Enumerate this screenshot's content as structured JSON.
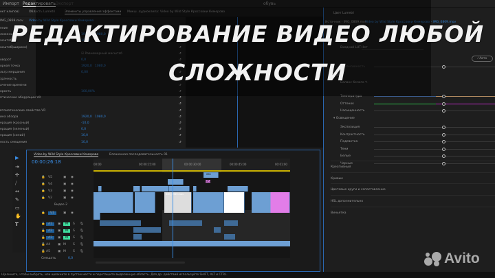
{
  "topbar": {
    "tabs": [
      "Импорт",
      "Редактировать",
      "Экспорт"
    ],
    "active": 1,
    "project": "обувь"
  },
  "panels": {
    "tabs": [
      "ект клипов)",
      "Область Lumetri",
      "Элементы управления эффектами",
      "Микш. аудиоклипа: Video by Wild Style Кроссовки Кемерово"
    ],
    "clip": "IMG_0869.mov",
    "seq": "Video by Wild Style Кроссовки Кемерово"
  },
  "effects": [
    {
      "l": "ение"
    },
    {
      "l": "ложение",
      "v": "1920,0",
      "v2": "1080,0"
    },
    {
      "l": "асштаб",
      "v": "100,0"
    },
    {
      "l": "асштаб(ширина)"
    },
    {
      "l": "",
      "check": "Равномерный масштаб"
    },
    {
      "l": "оворот",
      "v": "0,0"
    },
    {
      "l": "орная точка",
      "v": "1920,0",
      "v2": "1080,0"
    },
    {
      "l": "льтр мерцания",
      "v": "0,00"
    },
    {
      "l": "зрачность"
    },
    {
      "l": "ачение времени"
    },
    {
      "l": "орость",
      "v": "100,00%"
    },
    {
      "l": "птические аберрации VR"
    },
    {
      "l": ""
    },
    {
      "l": "втоматические свойства VR"
    },
    {
      "l": "ина обзора",
      "v": "1920,0",
      "v2": "1080,0"
    },
    {
      "l": "ерация (красный)",
      "v": "-10,0"
    },
    {
      "l": "ерация (зеленый)",
      "v": "0,0"
    },
    {
      "l": "ерация (синий)",
      "v": "10,0"
    },
    {
      "l": "ность смещения",
      "v": "10,0"
    }
  ],
  "lumetri": {
    "title": "Цвет Lumetri",
    "source": "Источник · IMG_0869.mov",
    "link": "Video by Wild Style Кроссовки Кемерово · IMG_0869.mov",
    "lut_label": "Входной LUT",
    "lut_value": "Нет",
    "auto": "Авто",
    "intensity": "Интенсивность",
    "color_head": "Цвет",
    "wb": "Баланс белого",
    "color_sliders": [
      "Температура",
      "Оттенок",
      "Насыщенность"
    ],
    "light_head": "Освещение",
    "light_sliders": [
      "Экспозиция",
      "Контрастность",
      "Подсветка",
      "Тени",
      "Белые",
      "Черные"
    ],
    "sections": [
      "Креативный",
      "Кривые",
      "Цветовые круги и сопоставление",
      "HSL дополнительно",
      "Виньетка"
    ],
    "colors": {
      "tint_green": "#2ec04a",
      "tint_magenta": "#c02cc8",
      "temp": "#b08a60"
    }
  },
  "timeline": {
    "tabs": [
      "Video by Wild Style Кроссовки Кемерово",
      "Вложенная последовательность 01"
    ],
    "timecode": "00:00:26:18",
    "ruler": [
      "00:00",
      "00:00:15:00",
      "00:00:30:00",
      "00:00:45:00",
      "00:01:00"
    ],
    "video_tracks": [
      "V5",
      "V4",
      "V3",
      "V2",
      "V1"
    ],
    "v2_name": "Видео 2",
    "audio_tracks": [
      "A1",
      "A2",
      "A3",
      "A4",
      "A5"
    ],
    "mix": "Смешать",
    "mix_value": "0,0",
    "clip_labels": [
      "IMG_0969.mov",
      "IMG",
      "MP4"
    ]
  },
  "status": "Щелкните, чтобы выбрать, или щелкните в пустом месте и перетащите выделенную область. Для др. действий используйте SHIFT, ALT и CTRL.",
  "headline": {
    "line1": "РЕДАКТИРОВАНИЕ ВИДЕО ЛЮБОЙ",
    "line2": "СЛОЖНОСТИ"
  },
  "watermark": "Avito"
}
